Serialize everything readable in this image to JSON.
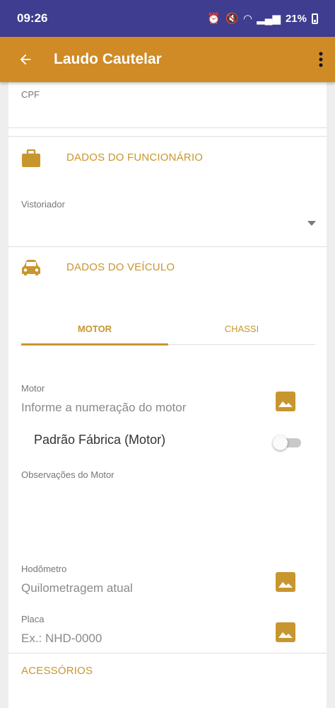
{
  "status_bar": {
    "time": "09:26",
    "battery": "21%"
  },
  "app_bar": {
    "title": "Laudo Cautelar"
  },
  "form": {
    "cpf_label": "CPF",
    "employee_section": {
      "title": "DADOS DO FUNCIONÁRIO",
      "vistoriador_label": "Vistoriador"
    },
    "vehicle_section": {
      "title": "DADOS DO VEÍCULO",
      "tabs": [
        {
          "label": "MOTOR",
          "selected": true
        },
        {
          "label": "CHASSI",
          "selected": false
        }
      ],
      "motor_label": "Motor",
      "motor_placeholder": "Informe a numeração do motor",
      "padrao_fabrica_label": "Padrão Fábrica (Motor)",
      "padrao_fabrica_on": false,
      "observacoes_label": "Observações do Motor",
      "hodometro_label": "Hodômetro",
      "hodometro_placeholder": "Quilometragem atual",
      "placa_label": "Placa",
      "placa_placeholder": "Ex.: NHD-0000"
    },
    "acessorios_title": "ACESSÓRIOS"
  },
  "colors": {
    "app_bar": "#d08a26",
    "status_bar": "#3f3d8f",
    "accent": "#c8962f"
  }
}
